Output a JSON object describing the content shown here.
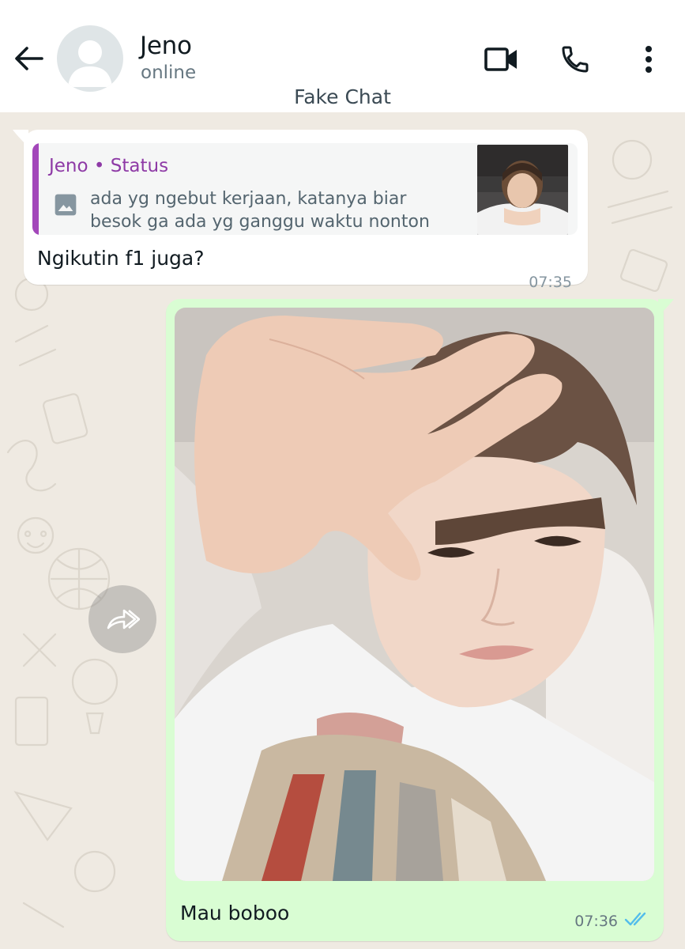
{
  "header": {
    "contact_name": "Jeno",
    "contact_status": "online",
    "watermark": "Fake Chat",
    "icons": [
      "back-arrow-icon",
      "avatar-placeholder-icon",
      "video-call-icon",
      "phone-icon",
      "more-vertical-icon"
    ]
  },
  "messages": [
    {
      "direction": "incoming",
      "quote": {
        "author": "Jeno • Status",
        "text": "ada yg ngebut kerjaan, katanya biar besok ga ada yg ganggu waktu nonton",
        "icon": "photo-icon"
      },
      "text": "Ngikutin f1 juga?",
      "time": "07:35"
    },
    {
      "direction": "outgoing",
      "attachment": "photo",
      "text": "Mau boboo",
      "time": "07:36",
      "status": "read"
    }
  ],
  "colors": {
    "header_bg": "#ffffff",
    "chat_bg": "#efeae2",
    "incoming_bubble": "#ffffff",
    "outgoing_bubble": "#d9fdd3",
    "quote_accent": "#a347ba",
    "read_ticks": "#53bdeb"
  }
}
